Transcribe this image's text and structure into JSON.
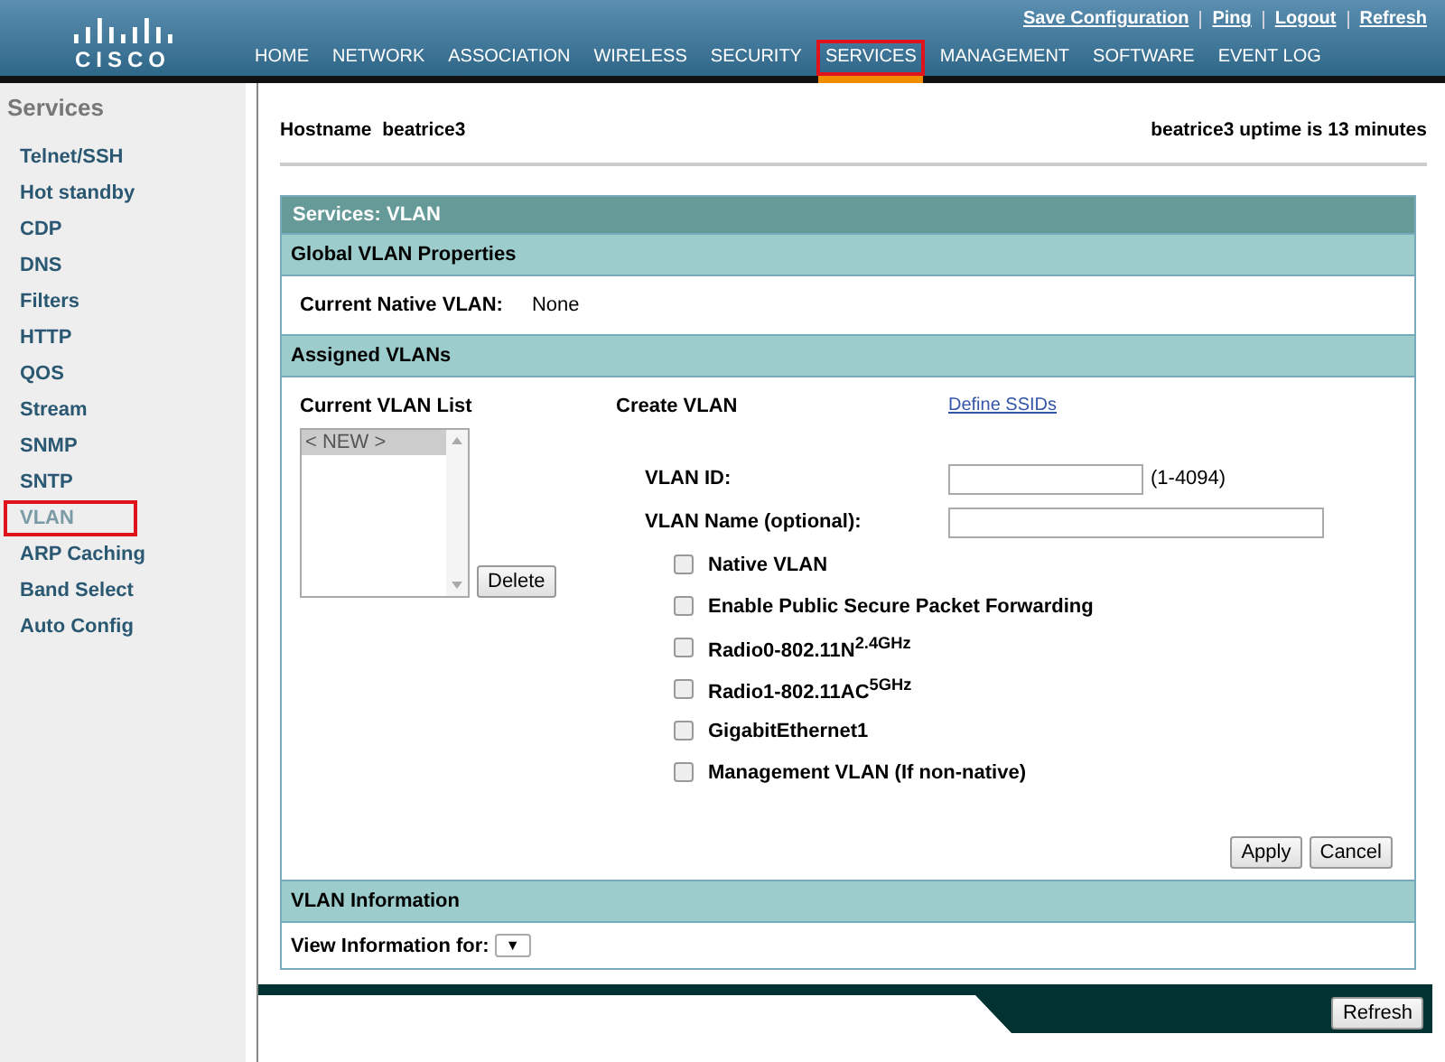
{
  "header": {
    "logo_text": "CISCO",
    "top_links": [
      {
        "label": "Save Configuration"
      },
      {
        "label": "Ping"
      },
      {
        "label": "Logout"
      },
      {
        "label": "Refresh"
      }
    ],
    "nav": [
      {
        "label": "HOME",
        "selected": false
      },
      {
        "label": "NETWORK",
        "selected": false
      },
      {
        "label": "ASSOCIATION",
        "selected": false
      },
      {
        "label": "WIRELESS",
        "selected": false
      },
      {
        "label": "SECURITY",
        "selected": false
      },
      {
        "label": "SERVICES",
        "selected": true
      },
      {
        "label": "MANAGEMENT",
        "selected": false
      },
      {
        "label": "SOFTWARE",
        "selected": false
      },
      {
        "label": "EVENT LOG",
        "selected": false
      }
    ]
  },
  "sidebar": {
    "title": "Services",
    "items": [
      {
        "label": "Telnet/SSH",
        "selected": false
      },
      {
        "label": "Hot standby",
        "selected": false
      },
      {
        "label": "CDP",
        "selected": false
      },
      {
        "label": "DNS",
        "selected": false
      },
      {
        "label": "Filters",
        "selected": false
      },
      {
        "label": "HTTP",
        "selected": false
      },
      {
        "label": "QOS",
        "selected": false
      },
      {
        "label": "Stream",
        "selected": false
      },
      {
        "label": "SNMP",
        "selected": false
      },
      {
        "label": "SNTP",
        "selected": false
      },
      {
        "label": "VLAN",
        "selected": true
      },
      {
        "label": "ARP Caching",
        "selected": false
      },
      {
        "label": "Band Select",
        "selected": false
      },
      {
        "label": "Auto Config",
        "selected": false
      }
    ]
  },
  "hostname": {
    "label": "Hostname",
    "value": "beatrice3",
    "uptime": "beatrice3 uptime is 13 minutes"
  },
  "panel": {
    "title": "Services: VLAN",
    "global": {
      "heading": "Global VLAN Properties",
      "native_label": "Current Native VLAN:",
      "native_value": "None"
    },
    "assigned": {
      "heading": "Assigned VLANs",
      "list_label": "Current VLAN List",
      "list_items": [
        {
          "label": "< NEW >",
          "selected": true
        }
      ],
      "delete_button": "Delete",
      "create_label": "Create VLAN",
      "define_link": "Define SSIDs",
      "vlan_id": {
        "label": "VLAN ID:",
        "hint": "(1-4094)"
      },
      "vlan_name": {
        "label": "VLAN Name (optional):"
      },
      "options": [
        {
          "label": "Native VLAN",
          "checked": false
        },
        {
          "label": "Enable Public Secure Packet Forwarding",
          "checked": false
        },
        {
          "label": "Radio0-802.11N$^{2.4GHz}$",
          "checked": false
        },
        {
          "label": "Radio1-802.11AC$^{5GHz}$",
          "checked": false
        },
        {
          "label": "GigabitEthernet1",
          "checked": false
        },
        {
          "label": "Management VLAN (If non-native)",
          "checked": false
        }
      ],
      "buttons": [
        "Apply",
        "Cancel"
      ]
    },
    "info": {
      "heading": "VLAN Information",
      "view_label": "View Information for:",
      "dropdown_caret": "▼"
    }
  },
  "footer": {
    "refresh_button": "Refresh"
  }
}
